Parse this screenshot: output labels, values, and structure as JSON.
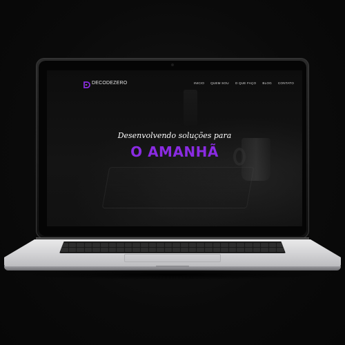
{
  "site": {
    "logo_text": "DECODEZERO",
    "nav": [
      "INICIO",
      "QUEM SOU",
      "O QUE FAÇO",
      "BLOG",
      "CONTATO"
    ],
    "hero": {
      "subtitle": "Desenvolvendo soluções para",
      "title": "O AMANHÃ"
    }
  },
  "colors": {
    "accent": "#8a2be2",
    "background": "#0b0b0b",
    "laptop_body": "#d7d7d9"
  },
  "icons": {
    "logo_mark": "decodezero-d-logo-icon"
  }
}
